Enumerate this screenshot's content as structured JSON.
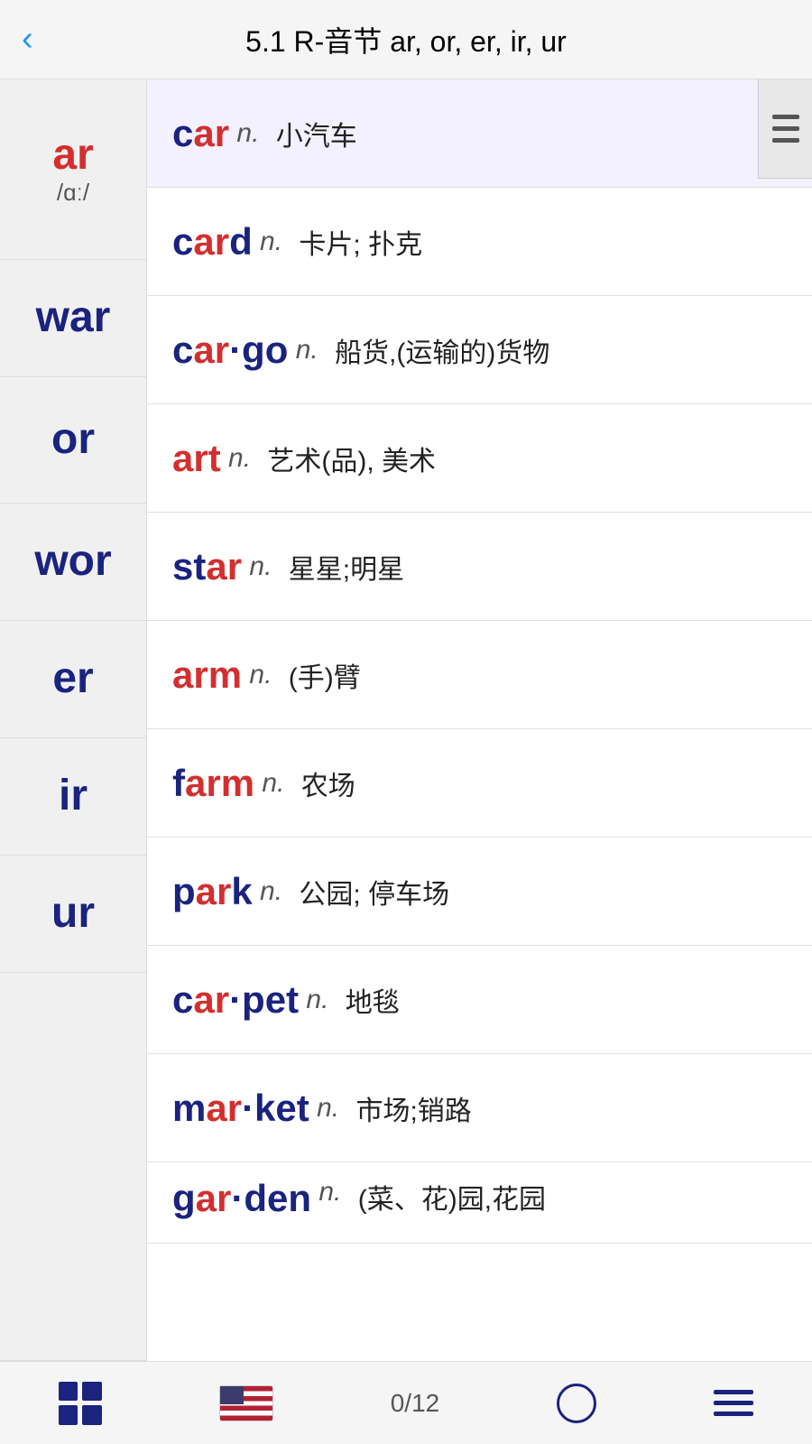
{
  "header": {
    "title": "5.1 R-音节 ar, or, er, ir, ur",
    "back_label": "‹"
  },
  "sidebar": {
    "items": [
      {
        "id": "ar",
        "label": "ar",
        "color": "red",
        "ipa": "/ɑː/"
      },
      {
        "id": "war",
        "label": "war",
        "color": "blue",
        "ipa": ""
      },
      {
        "id": "or",
        "label": "or",
        "color": "blue",
        "ipa": ""
      },
      {
        "id": "wor",
        "label": "wor",
        "color": "blue",
        "ipa": ""
      },
      {
        "id": "er",
        "label": "er",
        "color": "blue",
        "ipa": ""
      },
      {
        "id": "ir",
        "label": "ir",
        "color": "blue",
        "ipa": ""
      },
      {
        "id": "ur",
        "label": "ur",
        "color": "blue",
        "ipa": ""
      },
      {
        "id": "blank1",
        "label": "",
        "color": "blue",
        "ipa": ""
      },
      {
        "id": "blank2",
        "label": "",
        "color": "blue",
        "ipa": ""
      },
      {
        "id": "blank3",
        "label": "",
        "color": "blue",
        "ipa": ""
      },
      {
        "id": "blank4",
        "label": "",
        "color": "blue",
        "ipa": ""
      }
    ]
  },
  "words": [
    {
      "id": "car",
      "parts": [
        {
          "text": "car",
          "highlight": true
        }
      ],
      "pos": "n.",
      "def": "小汽车",
      "highlighted": true
    },
    {
      "id": "card",
      "parts": [
        {
          "text": "card",
          "highlight": true
        }
      ],
      "pos": "n.",
      "def": "卡片; 扑克"
    },
    {
      "id": "cargo",
      "parts": [
        {
          "text": "car",
          "highlight": false
        },
        {
          "text": "·go",
          "highlight": false,
          "bold_part": "car"
        }
      ],
      "pos": "n.",
      "def": "船货,(运输的)货物",
      "word_display": "car·go"
    },
    {
      "id": "art",
      "parts": [
        {
          "text": "art",
          "highlight": true
        }
      ],
      "pos": "n.",
      "def": "艺术(品), 美术"
    },
    {
      "id": "star",
      "parts": [
        {
          "text": "star",
          "highlight": true
        }
      ],
      "pos": "n.",
      "def": "星星;明星",
      "star_highlight": "st"
    },
    {
      "id": "arm",
      "parts": [
        {
          "text": "arm",
          "highlight": true
        }
      ],
      "pos": "n.",
      "def": "(手)臂"
    },
    {
      "id": "farm",
      "parts": [
        {
          "text": "farm",
          "highlight": true
        }
      ],
      "pos": "n.",
      "def": "农场"
    },
    {
      "id": "park",
      "parts": [
        {
          "text": "park",
          "highlight": true
        }
      ],
      "pos": "n.",
      "def": "公园; 停车场"
    },
    {
      "id": "carpet",
      "parts": [
        {
          "text": "car·pet",
          "highlight": true
        }
      ],
      "pos": "n.",
      "def": "地毯"
    },
    {
      "id": "market",
      "parts": [
        {
          "text": "mar·ket",
          "highlight": true
        }
      ],
      "pos": "n.",
      "def": "市场;销路"
    },
    {
      "id": "garden",
      "parts": [
        {
          "text": "gar·den",
          "highlight": true
        }
      ],
      "pos": "n.",
      "def": "(菜、花)园,花园",
      "partial": true
    }
  ],
  "toolbar": {
    "progress": "0/12",
    "grid_icon": "grid",
    "flag_icon": "us-flag",
    "circle_icon": "circle",
    "menu_icon": "menu"
  },
  "words_display": [
    {
      "id": "car",
      "blue": "car",
      "red_part": "ar",
      "pos": "n.",
      "def": "小汽车",
      "highlighted": true
    },
    {
      "id": "card",
      "blue": "card",
      "red_part": "ar",
      "pos": "n.",
      "def": "卡片; 扑克"
    },
    {
      "id": "cargo",
      "blue": "car·go",
      "red_part": "ar",
      "pos": "n.",
      "def": "船货,(运输的)货物"
    },
    {
      "id": "art",
      "blue": "art",
      "red_part": "ar",
      "pos": "n.",
      "def": "艺术(品), 美术",
      "red_word": true
    },
    {
      "id": "star",
      "blue": "star",
      "red_part": "ar",
      "pos": "n.",
      "def": "星星;明星",
      "prefix_blue": "st"
    },
    {
      "id": "arm",
      "blue": "arm",
      "red_part": "ar",
      "pos": "n.",
      "def": "(手)臂",
      "red_word": true
    },
    {
      "id": "farm",
      "blue": "farm",
      "red_part": "ar",
      "pos": "n.",
      "def": "农场",
      "prefix_blue": "f"
    },
    {
      "id": "park",
      "blue": "park",
      "red_part": "ar",
      "pos": "n.",
      "def": "公园; 停车场",
      "prefix_blue": "p"
    },
    {
      "id": "carpet",
      "blue": "car·pet",
      "red_part": "ar",
      "pos": "n.",
      "def": "地毯",
      "prefix_blue": "c"
    },
    {
      "id": "market",
      "blue": "mar·ket",
      "red_part": "ar",
      "pos": "n.",
      "def": "市场;销路",
      "prefix_blue": "m"
    },
    {
      "id": "garden",
      "blue": "gar·den",
      "red_part": "ar",
      "pos": "n.",
      "def": "(菜、花)园,花园",
      "prefix_blue": "g",
      "partial": true
    }
  ]
}
